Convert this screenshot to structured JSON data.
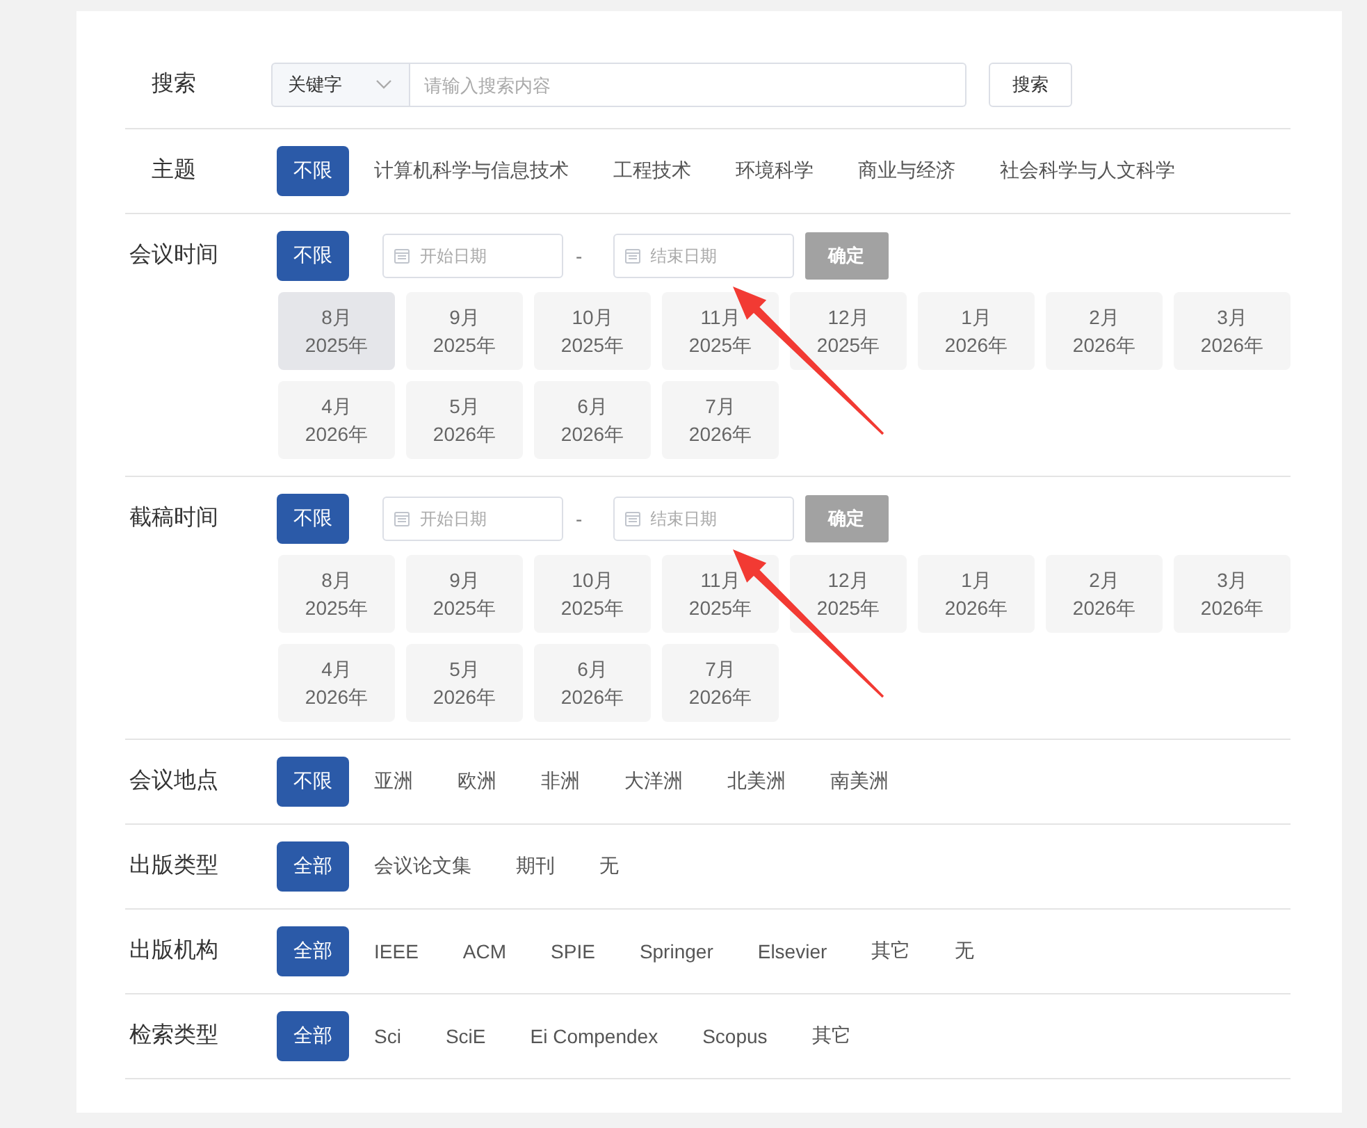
{
  "search": {
    "label": "搜索",
    "field_type": "关键字",
    "placeholder": "请输入搜索内容",
    "button": "搜索"
  },
  "filters": [
    {
      "kind": "options",
      "label": "主题",
      "options": [
        {
          "label": "不限",
          "selected": true
        },
        {
          "label": "计算机科学与信息技术",
          "selected": false
        },
        {
          "label": "工程技术",
          "selected": false
        },
        {
          "label": "环境科学",
          "selected": false
        },
        {
          "label": "商业与经济",
          "selected": false
        },
        {
          "label": "社会科学与人文科学",
          "selected": false
        }
      ]
    },
    {
      "kind": "dates",
      "label": "会议时间",
      "options": [
        {
          "label": "不限",
          "selected": true
        }
      ],
      "start_placeholder": "开始日期",
      "separator": "-",
      "end_placeholder": "结束日期",
      "confirm": "确定",
      "arrow_annotation": true,
      "months": [
        {
          "month": "8月",
          "year": "2025年",
          "selected": true
        },
        {
          "month": "9月",
          "year": "2025年",
          "selected": false
        },
        {
          "month": "10月",
          "year": "2025年",
          "selected": false
        },
        {
          "month": "11月",
          "year": "2025年",
          "selected": false
        },
        {
          "month": "12月",
          "year": "2025年",
          "selected": false
        },
        {
          "month": "1月",
          "year": "2026年",
          "selected": false
        },
        {
          "month": "2月",
          "year": "2026年",
          "selected": false
        },
        {
          "month": "3月",
          "year": "2026年",
          "selected": false
        },
        {
          "month": "4月",
          "year": "2026年",
          "selected": false
        },
        {
          "month": "5月",
          "year": "2026年",
          "selected": false
        },
        {
          "month": "6月",
          "year": "2026年",
          "selected": false
        },
        {
          "month": "7月",
          "year": "2026年",
          "selected": false
        }
      ]
    },
    {
      "kind": "dates",
      "label": "截稿时间",
      "options": [
        {
          "label": "不限",
          "selected": true
        }
      ],
      "start_placeholder": "开始日期",
      "separator": "-",
      "end_placeholder": "结束日期",
      "confirm": "确定",
      "arrow_annotation": true,
      "months": [
        {
          "month": "8月",
          "year": "2025年",
          "selected": false
        },
        {
          "month": "9月",
          "year": "2025年",
          "selected": false
        },
        {
          "month": "10月",
          "year": "2025年",
          "selected": false
        },
        {
          "month": "11月",
          "year": "2025年",
          "selected": false
        },
        {
          "month": "12月",
          "year": "2025年",
          "selected": false
        },
        {
          "month": "1月",
          "year": "2026年",
          "selected": false
        },
        {
          "month": "2月",
          "year": "2026年",
          "selected": false
        },
        {
          "month": "3月",
          "year": "2026年",
          "selected": false
        },
        {
          "month": "4月",
          "year": "2026年",
          "selected": false
        },
        {
          "month": "5月",
          "year": "2026年",
          "selected": false
        },
        {
          "month": "6月",
          "year": "2026年",
          "selected": false
        },
        {
          "month": "7月",
          "year": "2026年",
          "selected": false
        }
      ]
    },
    {
      "kind": "options",
      "label": "会议地点",
      "options": [
        {
          "label": "不限",
          "selected": true
        },
        {
          "label": "亚洲",
          "selected": false
        },
        {
          "label": "欧洲",
          "selected": false
        },
        {
          "label": "非洲",
          "selected": false
        },
        {
          "label": "大洋洲",
          "selected": false
        },
        {
          "label": "北美洲",
          "selected": false
        },
        {
          "label": "南美洲",
          "selected": false
        }
      ]
    },
    {
      "kind": "options",
      "label": "出版类型",
      "options": [
        {
          "label": "全部",
          "selected": true
        },
        {
          "label": "会议论文集",
          "selected": false
        },
        {
          "label": "期刊",
          "selected": false
        },
        {
          "label": "无",
          "selected": false
        }
      ]
    },
    {
      "kind": "options",
      "label": "出版机构",
      "options": [
        {
          "label": "全部",
          "selected": true
        },
        {
          "label": "IEEE",
          "selected": false
        },
        {
          "label": "ACM",
          "selected": false
        },
        {
          "label": "SPIE",
          "selected": false
        },
        {
          "label": "Springer",
          "selected": false
        },
        {
          "label": "Elsevier",
          "selected": false
        },
        {
          "label": "其它",
          "selected": false
        },
        {
          "label": "无",
          "selected": false
        }
      ]
    },
    {
      "kind": "options",
      "label": "检索类型",
      "options": [
        {
          "label": "全部",
          "selected": true
        },
        {
          "label": "Sci",
          "selected": false
        },
        {
          "label": "SciE",
          "selected": false
        },
        {
          "label": "Ei Compendex",
          "selected": false
        },
        {
          "label": "Scopus",
          "selected": false
        },
        {
          "label": "其它",
          "selected": false
        }
      ]
    }
  ]
}
